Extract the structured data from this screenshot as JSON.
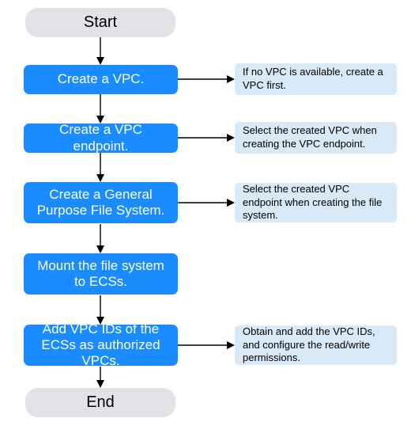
{
  "start": {
    "label": "Start"
  },
  "end": {
    "label": "End"
  },
  "steps": [
    {
      "id": "create-vpc",
      "label": "Create a VPC.",
      "note": "If no VPC is available, create a VPC first."
    },
    {
      "id": "create-endpoint",
      "label": "Create a VPC endpoint.",
      "note": "Select the created VPC when creating the VPC endpoint."
    },
    {
      "id": "create-fs",
      "label": "Create a General Purpose File System.",
      "note": "Select the created VPC endpoint when creating the file system."
    },
    {
      "id": "mount-fs",
      "label": "Mount the file system to ECSs.",
      "note": ""
    },
    {
      "id": "add-vpc-ids",
      "label": "Add VPC IDs of the ECSs as authorized VPCs.",
      "note": "Obtain and add the VPC IDs, and configure the read/write permissions."
    }
  ]
}
